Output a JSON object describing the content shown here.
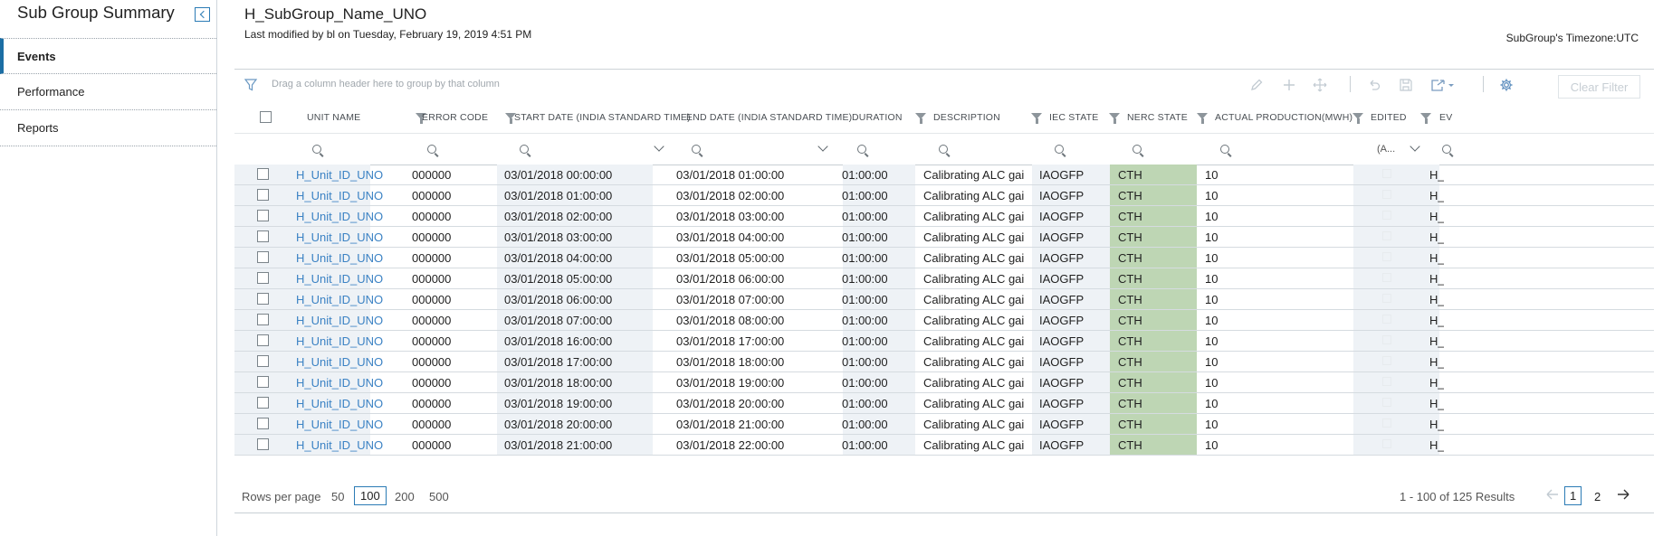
{
  "sidebar": {
    "title": "Sub Group Summary",
    "items": [
      {
        "label": "Events",
        "active": true
      },
      {
        "label": "Performance",
        "active": false
      },
      {
        "label": "Reports",
        "active": false
      }
    ]
  },
  "header": {
    "title": "H_SubGroup_Name_UNO",
    "last_modified": "Last modified by bl on Tuesday, February 19, 2019 4:51 PM",
    "timezone": "SubGroup's Timezone:UTC"
  },
  "toolbar": {
    "drag_hint": "Drag a column header here to group by that column",
    "clear_filter": "Clear Filter",
    "icons": [
      "pencil-icon",
      "plus-icon",
      "move-icon",
      "undo-icon",
      "save-icon",
      "export-icon",
      "gear-icon"
    ]
  },
  "columns": [
    {
      "key": "unit",
      "label": "UNIT NAME"
    },
    {
      "key": "error",
      "label": "ERROR CODE"
    },
    {
      "key": "start",
      "label": "START DATE (INDIA STANDARD TIME)"
    },
    {
      "key": "end",
      "label": "END DATE (INDIA STANDARD TIME)"
    },
    {
      "key": "duration",
      "label": "DURATION"
    },
    {
      "key": "desc",
      "label": "DESCRIPTION"
    },
    {
      "key": "iec",
      "label": "IEC STATE"
    },
    {
      "key": "nerc",
      "label": "NERC STATE"
    },
    {
      "key": "prod",
      "label": "ACTUAL PRODUCTION(MWH)"
    },
    {
      "key": "edited",
      "label": "EDITED"
    },
    {
      "key": "ev",
      "label": "EV"
    }
  ],
  "filters": {
    "edited_value": "(A..."
  },
  "rows": [
    {
      "unit": "H_Unit_ID_UNO",
      "error": "000000",
      "start": "03/01/2018 00:00:00",
      "end": "03/01/2018 01:00:00",
      "duration": "01:00:00",
      "desc": "Calibrating ALC gai...",
      "iec": "IAOGFP",
      "nerc": "CTH",
      "prod": "10",
      "ev": "H_"
    },
    {
      "unit": "H_Unit_ID_UNO",
      "error": "000000",
      "start": "03/01/2018 01:00:00",
      "end": "03/01/2018 02:00:00",
      "duration": "01:00:00",
      "desc": "Calibrating ALC gai...",
      "iec": "IAOGFP",
      "nerc": "CTH",
      "prod": "10",
      "ev": "H_"
    },
    {
      "unit": "H_Unit_ID_UNO",
      "error": "000000",
      "start": "03/01/2018 02:00:00",
      "end": "03/01/2018 03:00:00",
      "duration": "01:00:00",
      "desc": "Calibrating ALC gai...",
      "iec": "IAOGFP",
      "nerc": "CTH",
      "prod": "10",
      "ev": "H_"
    },
    {
      "unit": "H_Unit_ID_UNO",
      "error": "000000",
      "start": "03/01/2018 03:00:00",
      "end": "03/01/2018 04:00:00",
      "duration": "01:00:00",
      "desc": "Calibrating ALC gai...",
      "iec": "IAOGFP",
      "nerc": "CTH",
      "prod": "10",
      "ev": "H_"
    },
    {
      "unit": "H_Unit_ID_UNO",
      "error": "000000",
      "start": "03/01/2018 04:00:00",
      "end": "03/01/2018 05:00:00",
      "duration": "01:00:00",
      "desc": "Calibrating ALC gai...",
      "iec": "IAOGFP",
      "nerc": "CTH",
      "prod": "10",
      "ev": "H_"
    },
    {
      "unit": "H_Unit_ID_UNO",
      "error": "000000",
      "start": "03/01/2018 05:00:00",
      "end": "03/01/2018 06:00:00",
      "duration": "01:00:00",
      "desc": "Calibrating ALC gai...",
      "iec": "IAOGFP",
      "nerc": "CTH",
      "prod": "10",
      "ev": "H_"
    },
    {
      "unit": "H_Unit_ID_UNO",
      "error": "000000",
      "start": "03/01/2018 06:00:00",
      "end": "03/01/2018 07:00:00",
      "duration": "01:00:00",
      "desc": "Calibrating ALC gai...",
      "iec": "IAOGFP",
      "nerc": "CTH",
      "prod": "10",
      "ev": "H_"
    },
    {
      "unit": "H_Unit_ID_UNO",
      "error": "000000",
      "start": "03/01/2018 07:00:00",
      "end": "03/01/2018 08:00:00",
      "duration": "01:00:00",
      "desc": "Calibrating ALC gai...",
      "iec": "IAOGFP",
      "nerc": "CTH",
      "prod": "10",
      "ev": "H_"
    },
    {
      "unit": "H_Unit_ID_UNO",
      "error": "000000",
      "start": "03/01/2018 16:00:00",
      "end": "03/01/2018 17:00:00",
      "duration": "01:00:00",
      "desc": "Calibrating ALC gai...",
      "iec": "IAOGFP",
      "nerc": "CTH",
      "prod": "10",
      "ev": "H_"
    },
    {
      "unit": "H_Unit_ID_UNO",
      "error": "000000",
      "start": "03/01/2018 17:00:00",
      "end": "03/01/2018 18:00:00",
      "duration": "01:00:00",
      "desc": "Calibrating ALC gai...",
      "iec": "IAOGFP",
      "nerc": "CTH",
      "prod": "10",
      "ev": "H_"
    },
    {
      "unit": "H_Unit_ID_UNO",
      "error": "000000",
      "start": "03/01/2018 18:00:00",
      "end": "03/01/2018 19:00:00",
      "duration": "01:00:00",
      "desc": "Calibrating ALC gai...",
      "iec": "IAOGFP",
      "nerc": "CTH",
      "prod": "10",
      "ev": "H_"
    },
    {
      "unit": "H_Unit_ID_UNO",
      "error": "000000",
      "start": "03/01/2018 19:00:00",
      "end": "03/01/2018 20:00:00",
      "duration": "01:00:00",
      "desc": "Calibrating ALC gai...",
      "iec": "IAOGFP",
      "nerc": "CTH",
      "prod": "10",
      "ev": "H_"
    },
    {
      "unit": "H_Unit_ID_UNO",
      "error": "000000",
      "start": "03/01/2018 20:00:00",
      "end": "03/01/2018 21:00:00",
      "duration": "01:00:00",
      "desc": "Calibrating ALC gai...",
      "iec": "IAOGFP",
      "nerc": "CTH",
      "prod": "10",
      "ev": "H_"
    },
    {
      "unit": "H_Unit_ID_UNO",
      "error": "000000",
      "start": "03/01/2018 21:00:00",
      "end": "03/01/2018 22:00:00",
      "duration": "01:00:00",
      "desc": "Calibrating ALC gai...",
      "iec": "IAOGFP",
      "nerc": "CTH",
      "prod": "10",
      "ev": "H_"
    }
  ],
  "footer": {
    "rows_per_page_label": "Rows per page",
    "options": [
      "50",
      "100",
      "200",
      "500"
    ],
    "selected_option": "100",
    "range_text": "1 - 100 of 125 Results",
    "pages": [
      "1",
      "2"
    ],
    "current_page": "1"
  },
  "colors": {
    "accent": "#1c6ea4",
    "link": "#3b82c4",
    "nerc_bg": "#bed6b4",
    "alt_bg": "#eef2f6"
  }
}
